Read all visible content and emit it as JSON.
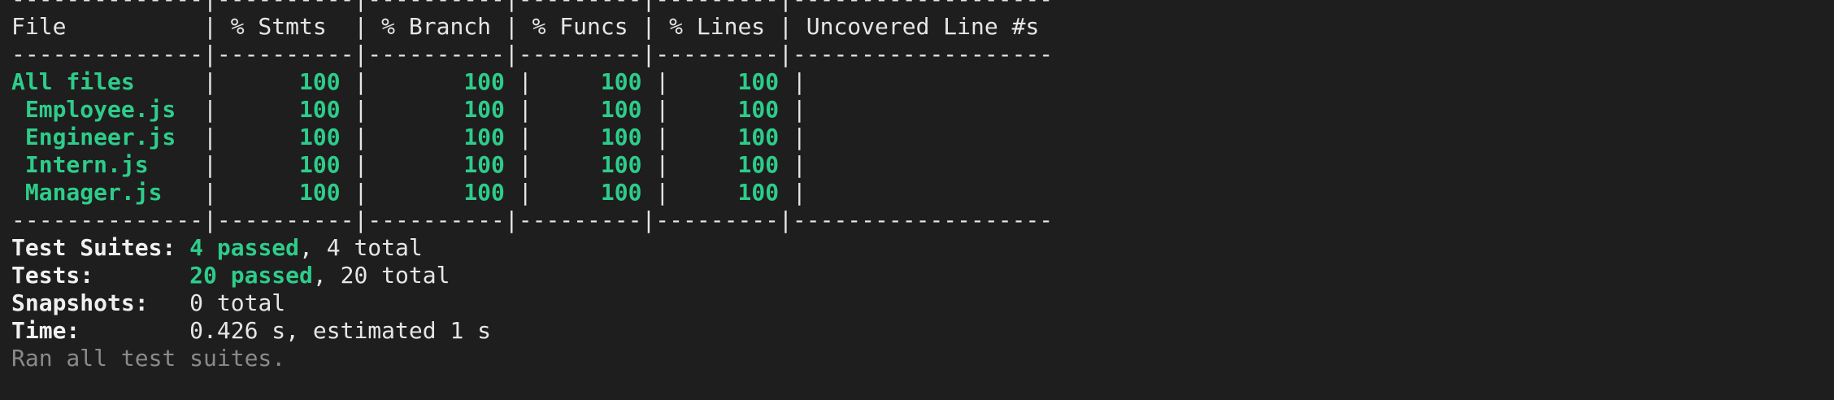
{
  "table": {
    "divider_top": "--------------|----------|----------|---------|---------|-------------------",
    "header": "File          | % Stmts  | % Branch | % Funcs | % Lines | Uncovered Line #s ",
    "divider_mid": "--------------|----------|----------|---------|---------|-------------------",
    "rows": [
      {
        "file": "All files    ",
        "stmts": "     100",
        "branch": "      100",
        "funcs": "    100",
        "lines": "    100",
        "uncovered": "                   "
      },
      {
        "file": " Employee.js ",
        "stmts": "     100",
        "branch": "      100",
        "funcs": "    100",
        "lines": "    100",
        "uncovered": "                   "
      },
      {
        "file": " Engineer.js ",
        "stmts": "     100",
        "branch": "      100",
        "funcs": "    100",
        "lines": "    100",
        "uncovered": "                   "
      },
      {
        "file": " Intern.js   ",
        "stmts": "     100",
        "branch": "      100",
        "funcs": "    100",
        "lines": "    100",
        "uncovered": "                   "
      },
      {
        "file": " Manager.js  ",
        "stmts": "     100",
        "branch": "      100",
        "funcs": "    100",
        "lines": "    100",
        "uncovered": "                   "
      }
    ],
    "divider_bottom": "--------------|----------|----------|---------|---------|-------------------"
  },
  "summary": {
    "test_suites_label": "Test Suites: ",
    "test_suites_passed": "4 passed",
    "test_suites_rest": ", 4 total",
    "tests_label": "Tests:       ",
    "tests_passed": "20 passed",
    "tests_rest": ", 20 total",
    "snapshots_label": "Snapshots:   ",
    "snapshots_value": "0 total",
    "time_label": "Time:        ",
    "time_value": "0.426 s, estimated 1 s",
    "ran_all": "Ran all test suites."
  },
  "colors": {
    "background": "#1e1e1e",
    "text": "#e6e6e6",
    "green": "#2ecc8a",
    "dim": "#8a8a8a"
  }
}
